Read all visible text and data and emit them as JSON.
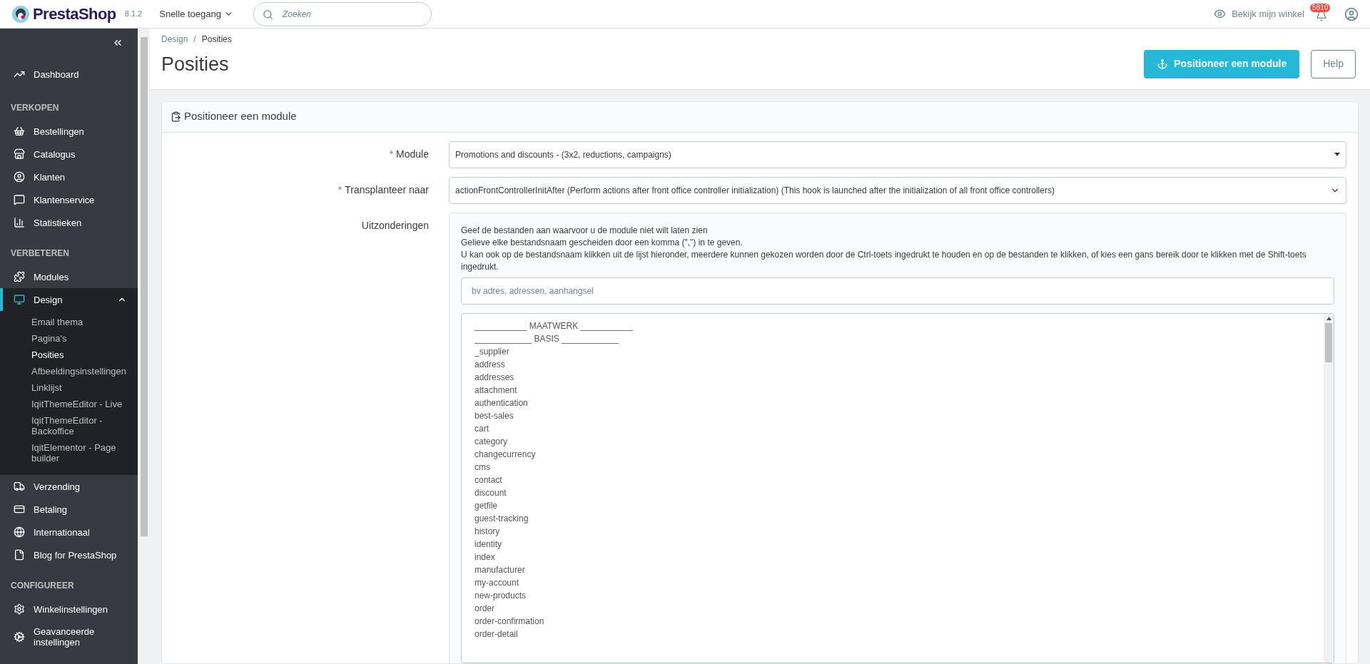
{
  "header": {
    "logo": "PrestaShop",
    "version": "8.1.2",
    "quick_access": "Snelle toegang",
    "search": {
      "placeholder": "Zoeken"
    },
    "view_shop": "Bekijk mijn winkel",
    "notifications_badge": "5810"
  },
  "sidebar": {
    "items": [
      {
        "kind": "item",
        "label": "Dashboard",
        "selected": false
      },
      {
        "kind": "section",
        "label": "VERKOPEN"
      },
      {
        "kind": "item",
        "label": "Bestellingen",
        "selected": false
      },
      {
        "kind": "item",
        "label": "Catalogus",
        "selected": false
      },
      {
        "kind": "item",
        "label": "Klanten",
        "selected": false
      },
      {
        "kind": "item",
        "label": "Klantenservice",
        "selected": false
      },
      {
        "kind": "item",
        "label": "Statistieken",
        "selected": false
      },
      {
        "kind": "section",
        "label": "VERBETEREN"
      },
      {
        "kind": "item",
        "label": "Modules",
        "selected": false
      },
      {
        "kind": "item",
        "label": "Design",
        "selected": true,
        "expanded": true,
        "children": [
          {
            "label": "Email thema",
            "selected": false
          },
          {
            "label": "Pagina's",
            "selected": false
          },
          {
            "label": "Posities",
            "selected": true
          },
          {
            "label": "Afbeeldingsinstellingen",
            "selected": false
          },
          {
            "label": "Linklijst",
            "selected": false
          },
          {
            "label": "IqitThemeEditor - Live",
            "selected": false
          },
          {
            "label": "IqitThemeEditor - Backoffice",
            "selected": false
          },
          {
            "label": "IqitElementor - Page builder",
            "selected": false
          }
        ]
      },
      {
        "kind": "item",
        "label": "Verzending",
        "selected": false
      },
      {
        "kind": "item",
        "label": "Betaling",
        "selected": false
      },
      {
        "kind": "item",
        "label": "Internationaal",
        "selected": false
      },
      {
        "kind": "item",
        "label": "Blog for PrestaShop",
        "selected": false
      },
      {
        "kind": "section",
        "label": "CONFIGUREER"
      },
      {
        "kind": "item",
        "label": "Winkelinstellingen",
        "selected": false
      },
      {
        "kind": "item",
        "label": "Geavanceerde instellingen",
        "selected": false
      }
    ]
  },
  "breadcrumb": {
    "items": [
      "Design",
      "Posities"
    ],
    "separator": "/"
  },
  "page_title": "Posities",
  "toolbar": {
    "primary_button": "Positioneer een module",
    "help_button": "Help"
  },
  "panel": {
    "title": "Positioneer een module",
    "module": {
      "label": "Module",
      "required_mark": "*",
      "value": "Promotions and discounts - (3x2, reductions, campaigns)"
    },
    "transplant": {
      "label": "Transplanteer naar",
      "required_mark": "*",
      "value": "actionFrontControllerInitAfter (Perform actions after front office controller initialization) (This hook is launched after the initialization of all front office controllers)"
    },
    "exceptions": {
      "label": "Uitzonderingen",
      "help": [
        "Geef de bestanden aan waarvoor u de module niet wilt laten zien",
        "Gelieve elke bestandsnaam gescheiden door een komma (\",\") in te geven.",
        "U kan ook op de bestandsnaam klikken uit de lijst hieronder, meerdere kunnen gekozen worden door de Ctrl-toets ingedrukt te houden en op de bestanden te klikken, of kies een gans bereik door te klikken met de Shift-toets ingedrukt."
      ],
      "input": {
        "placeholder": "bv adres, adressen, aanhangsel"
      },
      "files": [
        "___________ MAATWERK ___________",
        "____________ BASIS ____________",
        "_supplier",
        "address",
        "addresses",
        "attachment",
        "authentication",
        "best-sales",
        "cart",
        "category",
        "changecurrency",
        "cms",
        "contact",
        "discount",
        "getfile",
        "guest-tracking",
        "history",
        "identity",
        "index",
        "manufacturer",
        "my-account",
        "new-products",
        "order",
        "order-confirmation",
        "order-detail"
      ]
    }
  }
}
